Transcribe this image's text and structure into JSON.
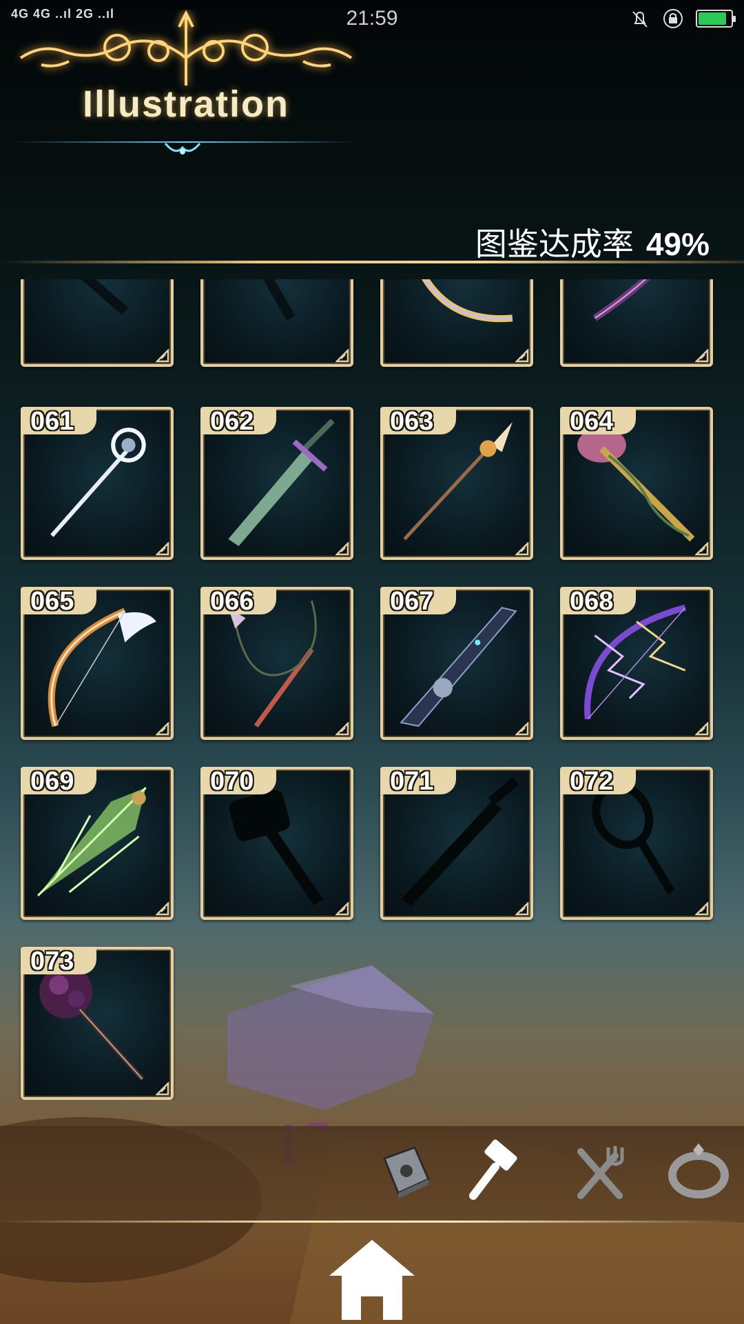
{
  "status_bar": {
    "signal": "4G 4G ..ıl 2G ..ıl",
    "time": "21:59",
    "icons": [
      "bell-muted-icon",
      "rotation-lock-icon",
      "battery-charging-icon"
    ],
    "battery_color": "#28c957"
  },
  "header": {
    "title": "Illustration"
  },
  "completion": {
    "label": "图鉴达成率",
    "percent": "49%"
  },
  "colors": {
    "card_border": "#e3cfa4",
    "badge_bg": "#e9d7ac",
    "gold_line": "#f3c87a"
  },
  "cards": [
    {
      "number": "",
      "art": "locked-silhouette-icon"
    },
    {
      "number": "",
      "art": "locked-silhouette-icon"
    },
    {
      "number": "",
      "art": "golden-bow-icon"
    },
    {
      "number": "",
      "art": "thorn-bow-icon"
    },
    {
      "number": "061",
      "art": "crystal-staff-icon"
    },
    {
      "number": "062",
      "art": "green-sword-icon"
    },
    {
      "number": "063",
      "art": "golden-spear-icon"
    },
    {
      "number": "064",
      "art": "vine-hammer-icon"
    },
    {
      "number": "065",
      "art": "winged-bow-icon"
    },
    {
      "number": "066",
      "art": "whip-staff-icon"
    },
    {
      "number": "067",
      "art": "mech-sword-icon"
    },
    {
      "number": "068",
      "art": "lightning-bow-icon"
    },
    {
      "number": "069",
      "art": "leaf-lance-icon"
    },
    {
      "number": "070",
      "art": "hammer-silhouette-icon"
    },
    {
      "number": "071",
      "art": "sword-silhouette-icon"
    },
    {
      "number": "072",
      "art": "racket-silhouette-icon"
    },
    {
      "number": "073",
      "art": "flower-mace-icon"
    }
  ],
  "bottom_nav": {
    "items": [
      "book-icon",
      "hammer-icon",
      "fork-knife-icon",
      "ring-icon"
    ],
    "home": "home-icon"
  }
}
